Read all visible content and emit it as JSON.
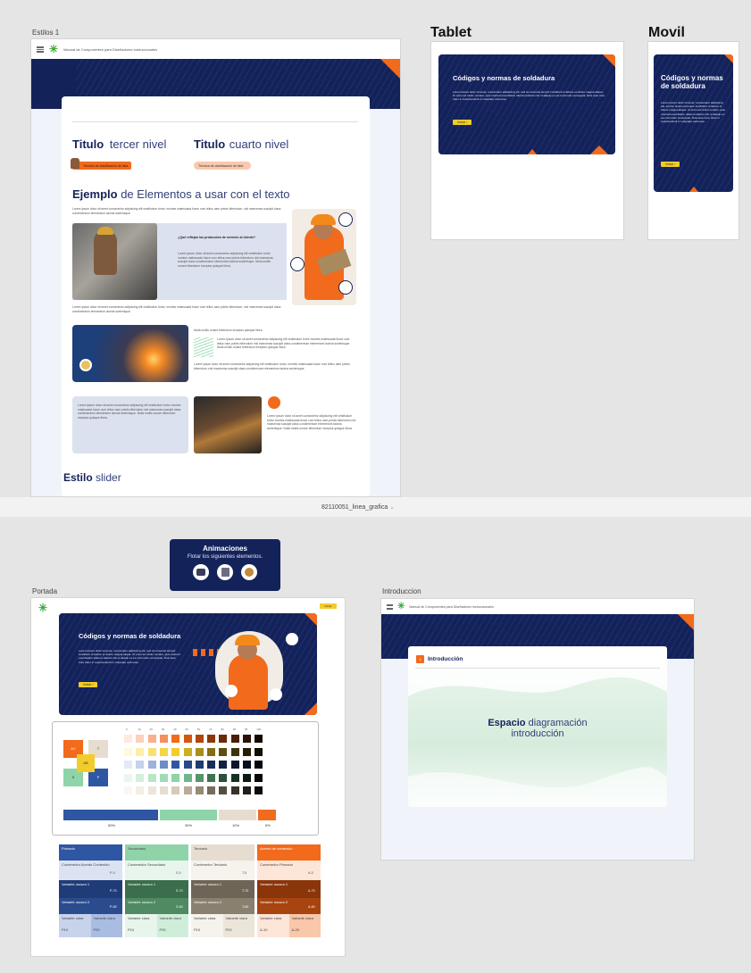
{
  "frames": {
    "estilos": "Estilos 1",
    "tablet": "Tablet",
    "movil": "Movil",
    "portada": "Portada",
    "introduccion": "Introduccion"
  },
  "header": {
    "manual": "Manual de Componentes para Diseñadores Instruccionales"
  },
  "estilos": {
    "h3_bold": "Titulo",
    "h3_light": "tercer nivel",
    "h4_bold": "Titulo",
    "h4_light": "cuarto nivel",
    "tag1": "Técnica de clasificación de lista",
    "tag2": "Técnica de clasificación de lista",
    "ejemplo_bold": "Ejemplo",
    "ejemplo_light": "de Elementos a usar con el texto",
    "lorem_long": "Lorem ipsum dolor sit amet consectetur adipiscing elit vestibulum tortor, montes malesuada fusce cum tellus nam primis bibendum, nisl maecenas suscipit class condimentum elementum lacinia scelerisque.",
    "question": "¿Qué reflejan los protocolos de servicio al cliente?",
    "lorem_mid": "Lorem ipsum dolor sit amet consectetur adipiscing elit vestibulum tortor montes malesuada fusce cum tellus nam primis bibendum nisl maecenas suscipit class condimentum elementum lacinia scelerisque. Nulla mollis ornare bibendum inceptos quisque litora.",
    "lorem_short": "Nulla mollis ornare bibendum inceptos quisque litora.",
    "estilo_bold": "Estilo",
    "estilo_light": "slider"
  },
  "hero": {
    "title": "Códigos y normas de soldadura",
    "text": "Lorem ipsum dolor sit amet, consectetur adipiscing elit, sed do eiusmod tempor incididunt ut labore et dolore magna aliqua. Ut enim ad minim veniam, quis nostrud exercitation ullamco laboris nisi ut aliquip ex ea commodo consequat. Duis aute irure dolor in reprehenderit in voluptate velit esse.",
    "button": "Iniciar"
  },
  "canvas_label": "82110051_linea_grafica",
  "animaciones": {
    "title": "Animaciones",
    "subtitle": "Flotar los siguientes elementos."
  },
  "palette": {
    "ratios": [
      "50%",
      "30%",
      "10%",
      "5%"
    ],
    "blocks": [
      "AC",
      "T",
      "AB",
      "S",
      "P"
    ],
    "cols": [
      "0",
      "10",
      "20",
      "30",
      "40",
      "50",
      "60",
      "70",
      "80",
      "90",
      "95",
      "100"
    ],
    "cards": [
      {
        "name": "Primario",
        "cont": "Contenedor Acento Contenido",
        "code": "P-5",
        "v1": "Variante oscura 1",
        "c1": "P-70",
        "v2": "Variante oscura 2",
        "c2": "P-60",
        "l1": "Variante clara",
        "l2": "Variante clara",
        "p1": "P10",
        "p2": "P25"
      },
      {
        "name": "Secundario",
        "cont": "Contenedor Secundario",
        "code": "S-5",
        "v1": "Variante oscura 1",
        "c1": "S-70",
        "v2": "Variante oscura 2",
        "c2": "S-60",
        "l1": "Variante clara",
        "l2": "Variante clara",
        "p1": "P10",
        "p2": "P25"
      },
      {
        "name": "Terciario",
        "cont": "Contenedor Terciario",
        "code": "T-5",
        "v1": "Variante oscura 1",
        "c1": "T-70",
        "v2": "Variante oscura 2",
        "c2": "T-60",
        "l1": "Variante clara",
        "l2": "Variante clara",
        "p1": "P10",
        "p2": "P20"
      },
      {
        "name": "Acento de contenido",
        "cont": "Contenedor Primario",
        "code": "A-5",
        "v1": "Variante oscura 1",
        "c1": "A-70",
        "v2": "Variante oscura 2",
        "c2": "A-60",
        "l1": "Variante clara",
        "l2": "Variante clara",
        "p1": "A-10",
        "p2": "A-20"
      }
    ]
  },
  "intro": {
    "title": "Introducción",
    "espacio_bold": "Espacio",
    "espacio_light": "diagramación",
    "espacio_line2": "introducción"
  },
  "colors": {
    "navy": "#14225a",
    "orange": "#f26a1b",
    "yellow": "#f2cc2a",
    "green": "#8fd4a8",
    "beige": "#e6ddd0",
    "blue": "#2f56a3"
  }
}
